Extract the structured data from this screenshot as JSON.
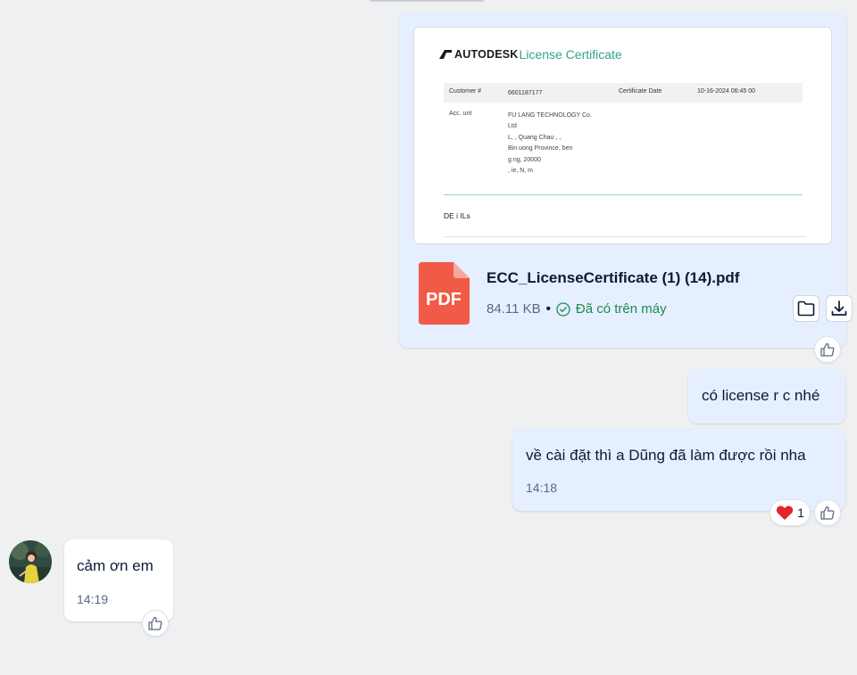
{
  "file_message": {
    "preview": {
      "brand": "AUTODESK",
      "title": "License Certificate",
      "table_headers": [
        "Customer #",
        "6601187177",
        "Certificate Date",
        "10-16-2024 06:45 00"
      ],
      "account_label": "Acc. unt",
      "account_lines": [
        "FU LANG TECHNOLOGY Co.",
        "Ltd",
        "L, , Quang Chau , ,",
        "Bin uong Province, ben",
        "g ng, 20000",
        ", ie, N, m"
      ],
      "details_label": "DE i ILs"
    },
    "file_name": "ECC_LicenseCertificate (1) (14).pdf",
    "file_size": "84.11 KB",
    "status": "Đã có trên máy",
    "pdf_badge": "PDF"
  },
  "messages": [
    {
      "text": "có license r c nhé"
    },
    {
      "text": "về cài đặt thì a Dũng đã làm được rồi nha",
      "time": "14:18",
      "reaction_count": "1"
    },
    {
      "text": "cảm ơn em",
      "time": "14:19"
    }
  ],
  "colors": {
    "sent_bubble": "#e5efff",
    "received_bubble": "#ffffff",
    "background": "#eef0f1",
    "pdf_red": "#f05a46",
    "status_green": "#1f8a4c",
    "autodesk_teal": "#31a38e"
  },
  "icons": [
    "thumbs-up-icon",
    "heart-icon",
    "folder-icon",
    "download-icon",
    "check-circle-icon",
    "pdf-file-icon"
  ]
}
